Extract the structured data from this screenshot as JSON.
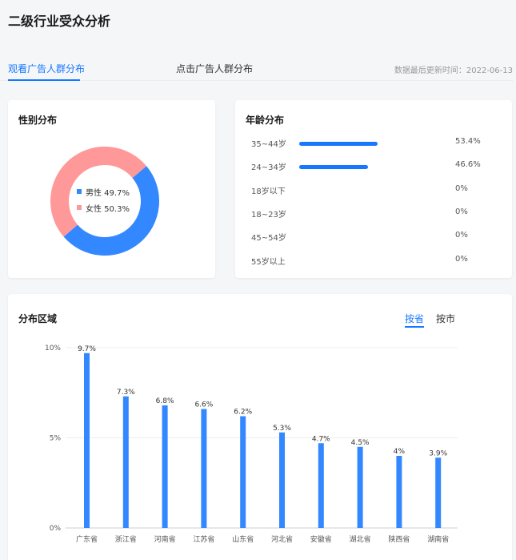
{
  "page": {
    "title": "二级行业受众分析"
  },
  "tabs": {
    "items": [
      {
        "label": "观看广告人群分布",
        "active": true
      },
      {
        "label": "点击广告人群分布",
        "active": false
      }
    ],
    "update_time": "数据最后更新时间：2022-06-13"
  },
  "gender": {
    "title": "性别分布",
    "items": [
      {
        "label": "男性 49.7%",
        "value": 49.7,
        "color": "#3388ff"
      },
      {
        "label": "女性 50.3%",
        "value": 50.3,
        "color": "#ff9999"
      }
    ]
  },
  "age": {
    "title": "年龄分布",
    "items": [
      {
        "label": "35~44岁",
        "value": 53.4,
        "display": "53.4%"
      },
      {
        "label": "24~34岁",
        "value": 46.6,
        "display": "46.6%"
      },
      {
        "label": "18岁以下",
        "value": 0,
        "display": "0%"
      },
      {
        "label": "18~23岁",
        "value": 0,
        "display": "0%"
      },
      {
        "label": "45~54岁",
        "value": 0,
        "display": "0%"
      },
      {
        "label": "55岁以上",
        "value": 0,
        "display": "0%"
      }
    ]
  },
  "region": {
    "title": "分布区域",
    "tab_province": "按省",
    "tab_city": "按市"
  },
  "chart_data": {
    "type": "bar",
    "title": "分布区域",
    "categories": [
      "广东省",
      "浙江省",
      "河南省",
      "江苏省",
      "山东省",
      "河北省",
      "安徽省",
      "湖北省",
      "陕西省",
      "湖南省"
    ],
    "values": [
      9.7,
      7.3,
      6.8,
      6.6,
      6.2,
      5.3,
      4.7,
      4.5,
      4,
      3.9
    ],
    "value_labels": [
      "9.7%",
      "7.3%",
      "6.8%",
      "6.6%",
      "6.2%",
      "5.3%",
      "4.7%",
      "4.5%",
      "4%",
      "3.9%"
    ],
    "yticks": [
      0,
      5,
      10
    ],
    "ytick_labels": [
      "0%",
      "5%",
      "10%"
    ],
    "ylim": [
      0,
      10
    ],
    "grid": true,
    "bar_color": "#3388ff"
  }
}
